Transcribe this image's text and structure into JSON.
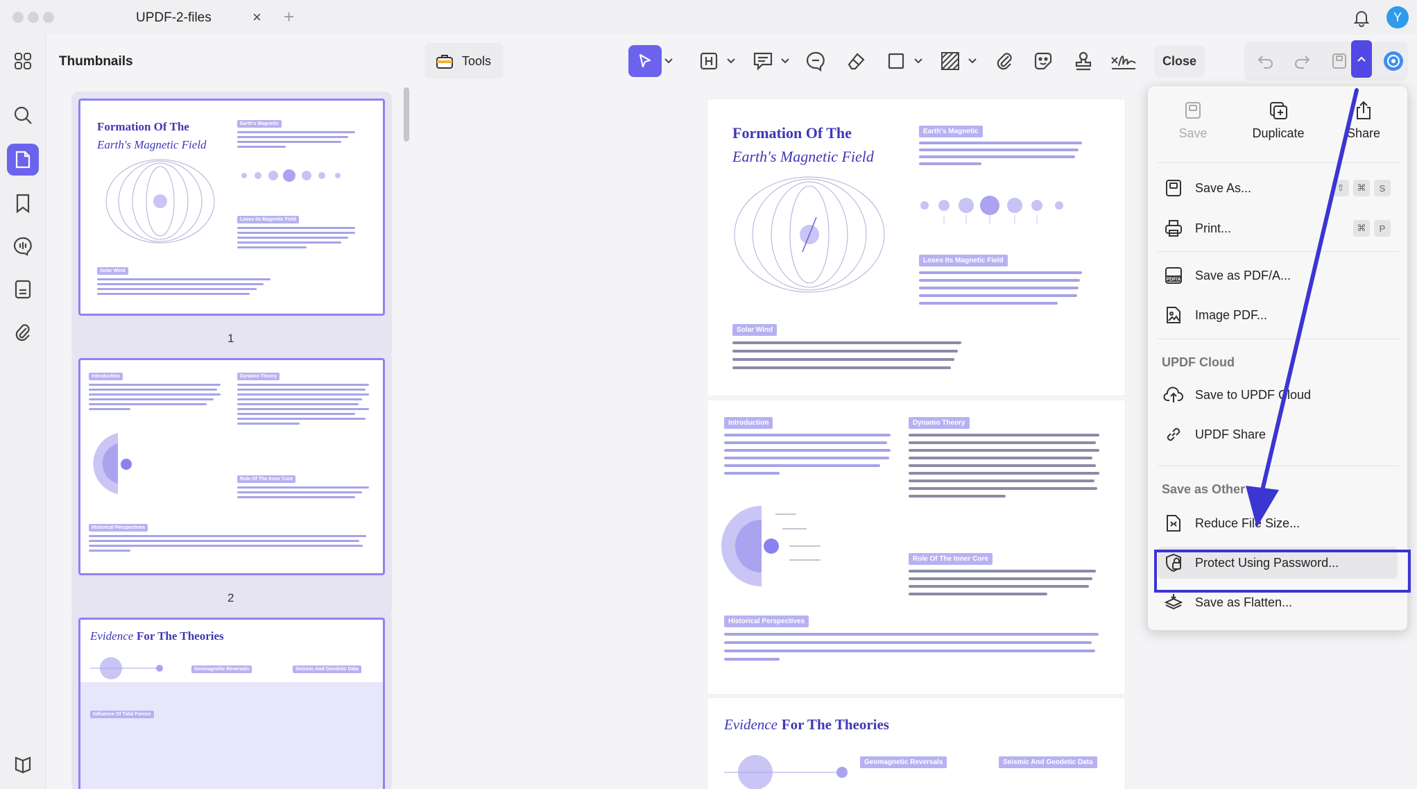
{
  "window": {
    "tab_title": "UPDF-2-files",
    "tab_close": "×",
    "tab_add": "+",
    "avatar_letter": "Y"
  },
  "rail": {
    "icons": [
      "apps-grid-icon",
      "search-icon",
      "page-edit-icon",
      "bookmark-icon",
      "comment-icon",
      "form-icon",
      "attachment-icon",
      "layers-icon"
    ]
  },
  "thumbnails": {
    "title": "Thumbnails",
    "pages": [
      "1",
      "2"
    ]
  },
  "toolbar": {
    "tools_label": "Tools",
    "close_label": "Close",
    "accent": "#6b63ee"
  },
  "document": {
    "page1": {
      "title_line1": "Formation Of The",
      "title_line2": "Earth's Magnetic Field",
      "pill_magnetic": "Earth's Magnetic",
      "pill_loses": "Loses Its Magnetic Field",
      "pill_solar": "Solar Wind"
    },
    "page2": {
      "pill_intro": "Introduction",
      "pill_dynamo": "Dynamo Theory",
      "pill_inner": "Role Of The Inner Core",
      "pill_hist": "Historical Perspectives"
    },
    "page3": {
      "title_italic": "Evidence",
      "title_rest": "For The Theories",
      "pill_geo": "Geomagnetic Reversals",
      "pill_seis": "Seismic And Geodetic Data",
      "pill_tidal": "Influence Of Tidal Forces"
    }
  },
  "menu": {
    "save": "Save",
    "duplicate": "Duplicate",
    "share": "Share",
    "save_as": "Save As...",
    "print": "Print...",
    "save_pdfa": "Save as PDF/A...",
    "image_pdf": "Image PDF...",
    "cloud_header": "UPDF Cloud",
    "save_cloud": "Save to UPDF Cloud",
    "updf_share": "UPDF Share",
    "other_header": "Save as Other",
    "reduce": "Reduce File Size...",
    "protect": "Protect Using Password...",
    "flatten": "Save as Flatten...",
    "save_as_keys": [
      "⇧",
      "⌘",
      "S"
    ],
    "print_keys": [
      "⌘",
      "P"
    ]
  }
}
